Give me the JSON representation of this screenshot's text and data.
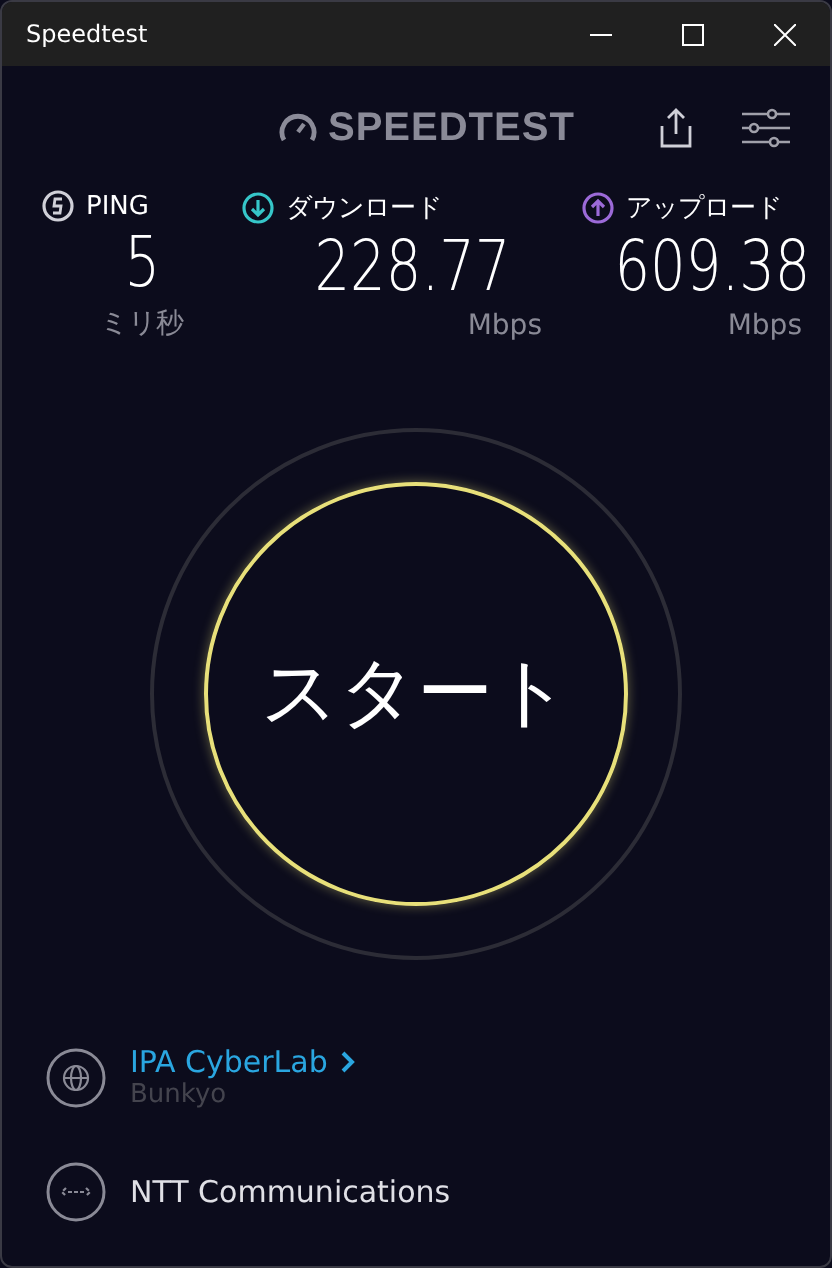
{
  "window": {
    "title": "Speedtest"
  },
  "header": {
    "logo": "SPEEDTEST"
  },
  "metrics": [
    {
      "label": "PING",
      "value": "5",
      "unit": "ミリ秒",
      "color": "#d0d0d8"
    },
    {
      "label": "ダウンロード",
      "value": "228.77",
      "unit": "Mbps",
      "color": "#36c6c9"
    },
    {
      "label": "アップロード",
      "value": "609.38",
      "unit": "Mbps",
      "color": "#9c6ad8"
    }
  ],
  "start_button": {
    "label": "スタート"
  },
  "server": {
    "name": "IPA CyberLab",
    "location": "Bunkyo"
  },
  "provider": {
    "name": "NTT Communications"
  }
}
